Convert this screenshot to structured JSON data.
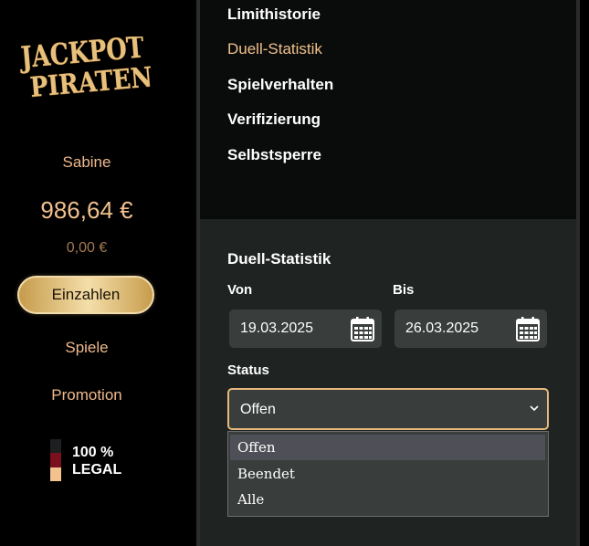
{
  "brand": {
    "logo_text_line1": "JACKPOT",
    "logo_text_line2": "PIRATEN"
  },
  "user": {
    "name": "Sabine",
    "balance": "986,64 €",
    "bonus_balance": "0,00 €"
  },
  "sidebar": {
    "deposit_label": "Einzahlen",
    "nav": [
      {
        "label": "Spiele"
      },
      {
        "label": "Promotion"
      }
    ],
    "legal": {
      "line1": "100 %",
      "line2": "LEGAL",
      "flag_colors": [
        "#1d1f20",
        "#7a0f1e",
        "#f3c28f"
      ]
    }
  },
  "account_menu": {
    "items": [
      {
        "label": "Limithistorie",
        "active": false
      },
      {
        "label": "Duell-Statistik",
        "active": true
      },
      {
        "label": "Spielverhalten",
        "active": false
      },
      {
        "label": "Verifizierung",
        "active": false
      },
      {
        "label": "Selbstsperre",
        "active": false
      }
    ]
  },
  "duel_stats": {
    "title": "Duell-Statistik",
    "from_label": "Von",
    "from_value": "19.03.2025",
    "to_label": "Bis",
    "to_value": "26.03.2025",
    "status_label": "Status",
    "status_value": "Offen",
    "status_options": [
      "Offen",
      "Beendet",
      "Alle"
    ]
  },
  "colors": {
    "accent": "#e8b97d",
    "sidebar_text": "#efb98c",
    "panel": "#1f2322",
    "field": "#393d3c"
  }
}
